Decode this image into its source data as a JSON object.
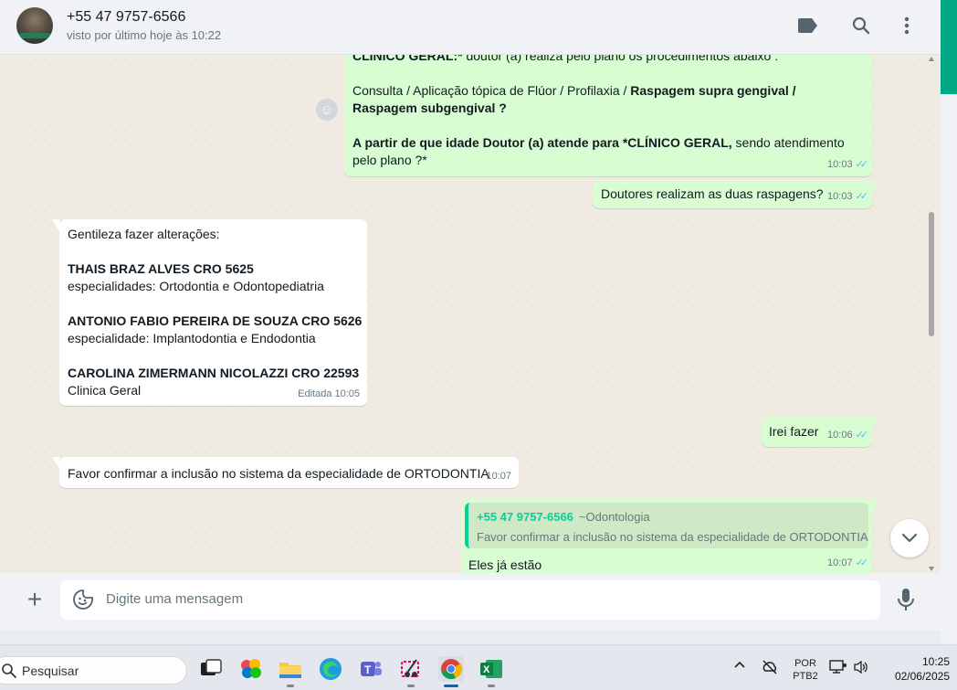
{
  "contact": {
    "name": "+55 47 9757-6566",
    "status": "visto por último hoje às 10:22"
  },
  "header_icons": [
    "label-icon",
    "search-icon",
    "menu-icon"
  ],
  "messages": {
    "m1": {
      "line1_bold": "CLÍNICO GERAL:*",
      "line1_rest": " doutor (a) realiza pelo plano os procedimentos abaixo :",
      "line2_plain": "Consulta /  Aplicação tópica de Flúor  /  Profilaxia / ",
      "line2_bold": "Raspagem supra gengival /",
      "line3_bold": "Raspagem subgengival ?",
      "line4_bold": " A partir de que idade Doutor (a) atende para *CLÍNICO GERAL,",
      "line4_rest": " sendo atendimento",
      "line5": "pelo plano ?*",
      "time": "10:03"
    },
    "m2": {
      "text": "Doutores realizam as duas raspagens?",
      "time": "10:03"
    },
    "m3": {
      "intro": "Gentileza fazer alterações:",
      "d1_name": "THAIS BRAZ ALVES CRO 5625",
      "d1_spec": "especialidades: Ortodontia e Odontopediatria",
      "d2_name": "ANTONIO FABIO PEREIRA DE SOUZA CRO 5626",
      "d2_spec": "especialidade: Implantodontia e Endodontia",
      "d3_name": "CAROLINA ZIMERMANN NICOLAZZI CRO 22593",
      "d3_spec": "Clinica Geral",
      "edited": "Editada",
      "time": "10:05"
    },
    "m4": {
      "text": "Irei fazer",
      "time": "10:06"
    },
    "m5": {
      "text": "Favor confirmar a inclusão no sistema da especialidade de ORTODONTIA",
      "time": "10:07"
    },
    "m6": {
      "quote_name": "+55 47 9757-6566",
      "quote_push": "~Odontologia",
      "quote_text": "Favor confirmar a inclusão no sistema da especialidade de ORTODONTIA",
      "text": "Eles já estão",
      "time": "10:07"
    }
  },
  "composer": {
    "placeholder": "Digite uma mensagem"
  },
  "taskbar": {
    "search_label": "Pesquisar",
    "lang_top": "POR",
    "lang_bottom": "PTB2",
    "time": "10:25",
    "date": "02/06/2025"
  },
  "colors": {
    "accent": "#00a884",
    "outgoing": "#d9fdd3",
    "incoming": "#ffffff",
    "read_ticks": "#53bdeb"
  }
}
